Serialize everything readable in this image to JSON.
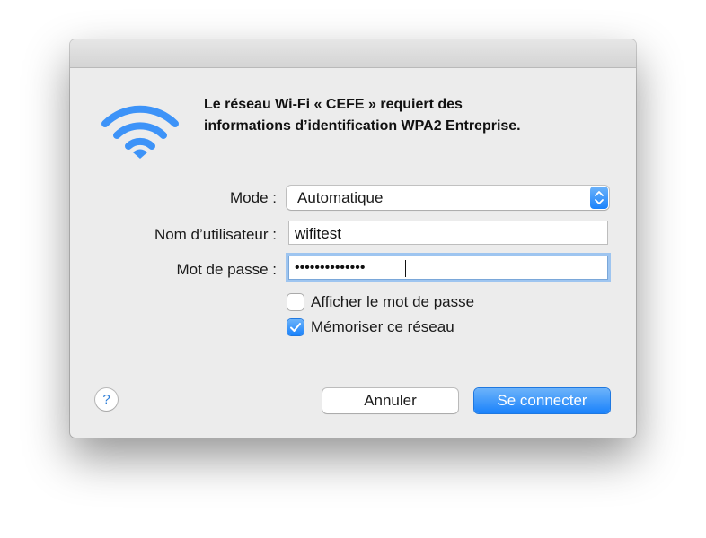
{
  "dialog": {
    "headline_line1": "Le réseau Wi-Fi « CEFE » requiert des",
    "headline_line2": "informations d’identification WPA2 Entreprise.",
    "icon": "wifi-icon",
    "accent_color": "#3d93f8"
  },
  "form": {
    "mode_label": "Mode :",
    "mode_value": "Automatique",
    "username_label": "Nom d’utilisateur :",
    "username_value": "wifitest",
    "password_label": "Mot de passe :",
    "password_masked": "••••••••••••••",
    "show_password_label": "Afficher le mot de passe",
    "show_password_checked": false,
    "remember_network_label": "Mémoriser ce réseau",
    "remember_network_checked": true
  },
  "footer": {
    "help_label": "?",
    "cancel_label": "Annuler",
    "connect_label": "Se connecter"
  }
}
